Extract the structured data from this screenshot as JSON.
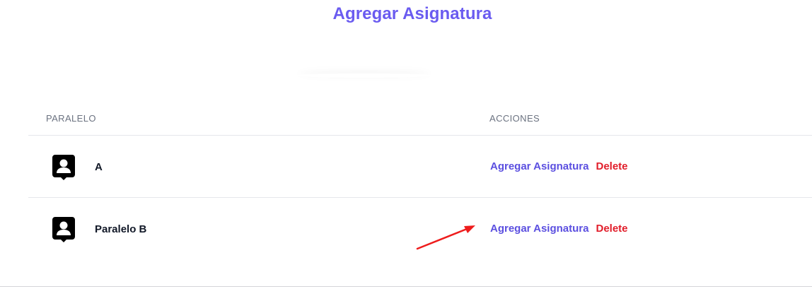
{
  "page": {
    "title": "Agregar Asignatura"
  },
  "table": {
    "headers": {
      "paralelo": "PARALELO",
      "acciones": "ACCIONES"
    },
    "rows": [
      {
        "name": "A",
        "add_label": "Agregar Asignatura",
        "delete_label": "Delete",
        "icon": "contact-card-icon"
      },
      {
        "name": "Paralelo B",
        "add_label": "Agregar Asignatura",
        "delete_label": "Delete",
        "icon": "contact-card-icon"
      }
    ]
  },
  "colors": {
    "title": "#6a5bf0",
    "add_link": "#5b4fe0",
    "delete_link": "#e11d2a",
    "annotation_arrow": "#ee1c1c"
  },
  "annotation": {
    "icon": "red-arrow-icon"
  }
}
